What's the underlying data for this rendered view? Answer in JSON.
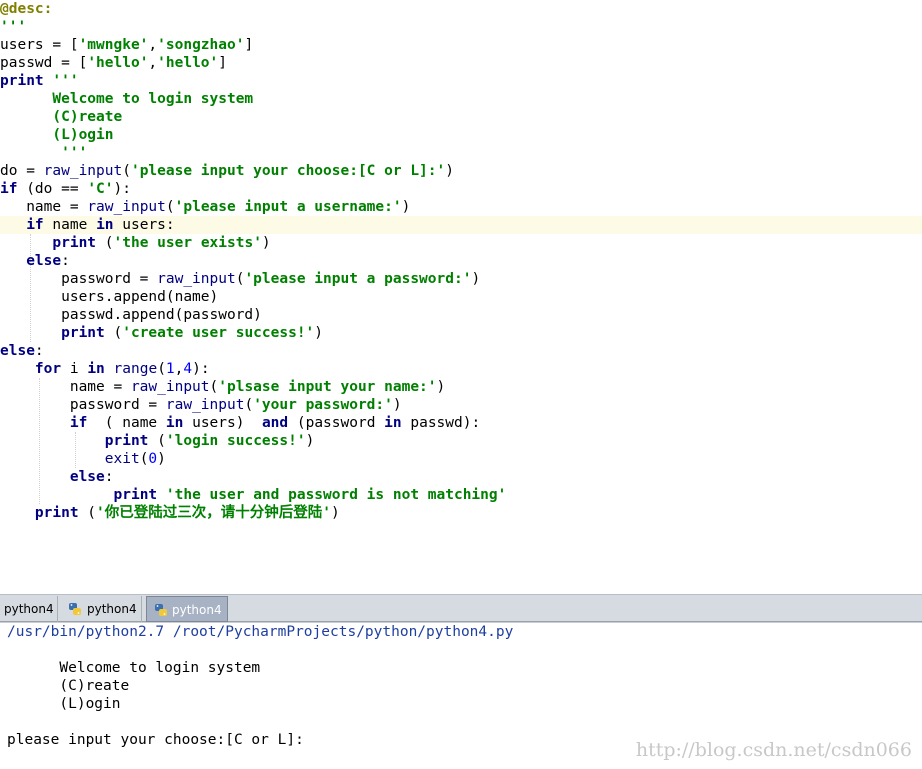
{
  "editor": {
    "lines": [
      [
        "@desc:"
      ],
      [
        "'''"
      ],
      [
        "users = [",
        "'mwngke'",
        ",",
        "'songzhao'",
        "]"
      ],
      [
        "passwd = [",
        "'hello'",
        ",",
        "'hello'",
        "]"
      ],
      [
        "print",
        " ",
        "'''"
      ],
      [
        "      Welcome to login system"
      ],
      [
        "      (C)reate"
      ],
      [
        "      (L)ogin"
      ],
      [
        "       '''"
      ],
      [
        "do = ",
        "raw_input",
        "(",
        "'please input your choose:[C or L]:'",
        ")"
      ],
      [
        "if",
        " (do == ",
        "'C'",
        "):"
      ],
      [
        "   name = ",
        "raw_input",
        "(",
        "'please input a username:'",
        ")"
      ],
      [
        "   ",
        "if",
        " name ",
        "in",
        " users:"
      ],
      [
        "      ",
        "print",
        " (",
        "'the user exists'",
        ")"
      ],
      [
        "   ",
        "else",
        ":"
      ],
      [
        "       password = ",
        "raw_input",
        "(",
        "'please input a password:'",
        ")"
      ],
      [
        "       users.append(name)"
      ],
      [
        "       passwd.append(password)"
      ],
      [
        "       ",
        "print",
        " (",
        "'create user success!'",
        ")"
      ],
      [
        "else",
        ":"
      ],
      [
        "    ",
        "for",
        " i ",
        "in",
        " ",
        "range",
        "(",
        "1",
        ",",
        "4",
        "):"
      ],
      [
        "        name = ",
        "raw_input",
        "(",
        "'plsase input your name:'",
        ")"
      ],
      [
        "        password = ",
        "raw_input",
        "(",
        "'your password:'",
        ")"
      ],
      [
        "        ",
        "if",
        "  ( name ",
        "in",
        " users)  ",
        "and",
        " (password ",
        "in",
        " passwd):"
      ],
      [
        "            ",
        "print",
        " (",
        "'login success!'",
        ")"
      ],
      [
        "            ",
        "exit",
        "(",
        "0",
        ")"
      ],
      [
        "        ",
        "else",
        ":"
      ],
      [
        "             ",
        "print",
        " ",
        "'the user and password is not matching'"
      ],
      [
        "    ",
        "print",
        " (",
        "'你已登陆过三次，请十分钟后登陆'",
        ")"
      ]
    ],
    "styles": [
      [
        "dec"
      ],
      [
        "str"
      ],
      [
        "",
        "str",
        "",
        "str",
        ""
      ],
      [
        "",
        "str",
        "",
        "str",
        ""
      ],
      [
        "kw",
        "",
        "str"
      ],
      [
        "str"
      ],
      [
        "str"
      ],
      [
        "str"
      ],
      [
        "str"
      ],
      [
        "",
        "bi",
        "",
        "str",
        ""
      ],
      [
        "kw",
        "",
        "str",
        ""
      ],
      [
        "",
        "bi",
        "",
        "str",
        ""
      ],
      [
        "",
        "kw",
        "",
        "kw",
        ""
      ],
      [
        "",
        "kw",
        "",
        "str",
        ""
      ],
      [
        "",
        "kw",
        ""
      ],
      [
        "",
        "bi",
        "",
        "str",
        ""
      ],
      [
        ""
      ],
      [
        ""
      ],
      [
        "",
        "kw",
        "",
        "str",
        ""
      ],
      [
        "kw",
        ""
      ],
      [
        "",
        "kw",
        "",
        "kw",
        "",
        "bi",
        "",
        "num",
        "",
        "num",
        ""
      ],
      [
        "",
        "bi",
        "",
        "str",
        ""
      ],
      [
        "",
        "bi",
        "",
        "str",
        ""
      ],
      [
        "",
        "kw",
        "",
        "kw",
        "",
        "kw",
        "",
        "kw",
        ""
      ],
      [
        "",
        "kw",
        "",
        "str",
        ""
      ],
      [
        "",
        "bi",
        "",
        "num",
        ""
      ],
      [
        "",
        "kw",
        ""
      ],
      [
        "",
        "kw",
        "",
        "str"
      ],
      [
        "",
        "kw",
        "",
        "str",
        ""
      ]
    ]
  },
  "tabs": [
    {
      "label": "python4",
      "icon": ""
    },
    {
      "label": "python4",
      "icon": "python-icon"
    },
    {
      "label": "python4",
      "icon": "python-icon"
    }
  ],
  "console": {
    "command": "/usr/bin/python2.7 /root/PycharmProjects/python/python4.py",
    "output": [
      "",
      "      Welcome to login system",
      "      (C)reate",
      "      (L)ogin",
      "",
      "please input your choose:[C or L]:"
    ]
  },
  "watermark": "http://blog.csdn.net/csdn066",
  "colors": {
    "keyword": "#000080",
    "string": "#008000",
    "decorator": "#808000",
    "number": "#0000ff",
    "tab_active_bg": "#a7b3c4",
    "console_path": "#1f3fa0"
  }
}
